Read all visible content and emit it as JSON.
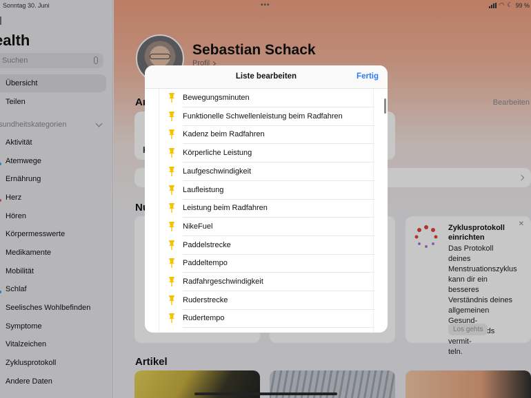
{
  "status_bar": {
    "date": "Sonntag 30. Juni",
    "battery": "99 %"
  },
  "sidebar": {
    "title": "ealth",
    "search_placeholder": "Suchen",
    "items_top": [
      {
        "label": "Übersicht",
        "selected": true
      },
      {
        "label": "Teilen",
        "selected": false
      }
    ],
    "section_header": "sundheitskategorien",
    "categories": [
      "Aktivität",
      "Atemwege",
      "Ernährung",
      "Herz",
      "Hören",
      "Körpermesswerte",
      "Medikamente",
      "Mobilität",
      "Schlaf",
      "Seelisches Wohlbefinden",
      "Symptome",
      "Vitalzeichen",
      "Zyklusprotokoll",
      "Andere Daten"
    ]
  },
  "main": {
    "user_name": "Sebastian Schack",
    "profile_link": "Profil",
    "section_1_fragment": "Ar",
    "section_1_edit": "Bearbeiten",
    "section_2_fragment": "Nu",
    "card_fragment": "K",
    "zyklus_card": {
      "title": "Zyklusprotokoll einrichten",
      "body": "Das Protokoll deines\nMenstruationszyklus\nkann dir ein besseres\nVerständnis deines\nallgemeinen Gesund-\nheitszustands vermit-\nteln.",
      "button": "Los gehts",
      "close": "✕"
    },
    "articles_heading": "Artikel"
  },
  "modal": {
    "title": "Liste bearbeiten",
    "done": "Fertig",
    "items": [
      "Bewegungsminuten",
      "Funktionelle Schwellenleistung beim Radfahren",
      "Kadenz beim Radfahren",
      "Körperliche Leistung",
      "Laufgeschwindigkeit",
      "Laufleistung",
      "Leistung beim Radfahren",
      "NikeFuel",
      "Paddelstrecke",
      "Paddeltempo",
      "Radfahrgeschwindigkeit",
      "Ruderstrecke",
      "Rudertempo"
    ]
  },
  "colors": {
    "accent": "#2f7bf5",
    "pin": "#f5c400",
    "header_gradient_top": "#f0a080"
  },
  "icons": {
    "list_item": "pin-icon",
    "search": "microphone-icon"
  }
}
